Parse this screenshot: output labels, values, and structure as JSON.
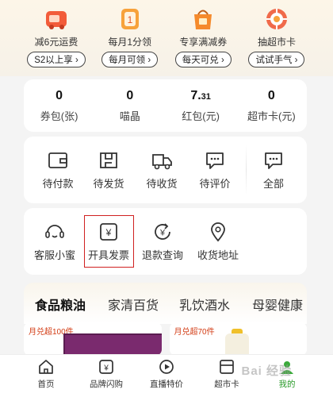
{
  "promos": [
    {
      "title": "减6元运费",
      "pill": "S2以上享",
      "icon": "delivery-truck-icon",
      "color": "#f25c3a"
    },
    {
      "title": "每月1分领",
      "pill": "每月可领",
      "icon": "coupon-icon",
      "color": "#f7a23b"
    },
    {
      "title": "专享满减券",
      "pill": "每天可兑",
      "icon": "voucher-bag-icon",
      "color": "#f58a2c"
    },
    {
      "title": "抽超市卡",
      "pill": "试试手气",
      "icon": "lucky-wheel-icon",
      "color": "#f06a4a"
    }
  ],
  "stats": [
    {
      "value": "0",
      "suffix": "",
      "label": "券包(张)"
    },
    {
      "value": "0",
      "suffix": "",
      "label": "喵晶"
    },
    {
      "value": "7.",
      "suffix": "31",
      "label": "红包(元)"
    },
    {
      "value": "0",
      "suffix": "",
      "label": "超市卡(元)"
    }
  ],
  "orders": [
    {
      "label": "待付款",
      "icon": "wallet-icon"
    },
    {
      "label": "待发货",
      "icon": "package-icon"
    },
    {
      "label": "待收货",
      "icon": "truck-icon"
    },
    {
      "label": "待评价",
      "icon": "comment-icon"
    },
    {
      "label": "全部",
      "icon": "all-orders-icon"
    }
  ],
  "services": [
    {
      "label": "客服小蜜",
      "icon": "customer-service-icon"
    },
    {
      "label": "开具发票",
      "icon": "invoice-icon"
    },
    {
      "label": "退款查询",
      "icon": "refund-icon"
    },
    {
      "label": "收货地址",
      "icon": "location-icon"
    }
  ],
  "tabs": [
    "食品粮油",
    "家清百货",
    "乳饮酒水",
    "母婴健康"
  ],
  "products": [
    {
      "tag": "月兑超100件"
    },
    {
      "tag": "月兑超70件"
    }
  ],
  "nav": [
    {
      "label": "首页",
      "icon": "home-icon",
      "active": false
    },
    {
      "label": "品牌闪购",
      "icon": "brand-flash-icon",
      "active": false
    },
    {
      "label": "直播特价",
      "icon": "live-icon",
      "active": false
    },
    {
      "label": "超市卡",
      "icon": "card-icon",
      "active": false
    },
    {
      "label": "我的",
      "icon": "profile-icon",
      "active": true
    }
  ],
  "watermark": "Bai 经验"
}
